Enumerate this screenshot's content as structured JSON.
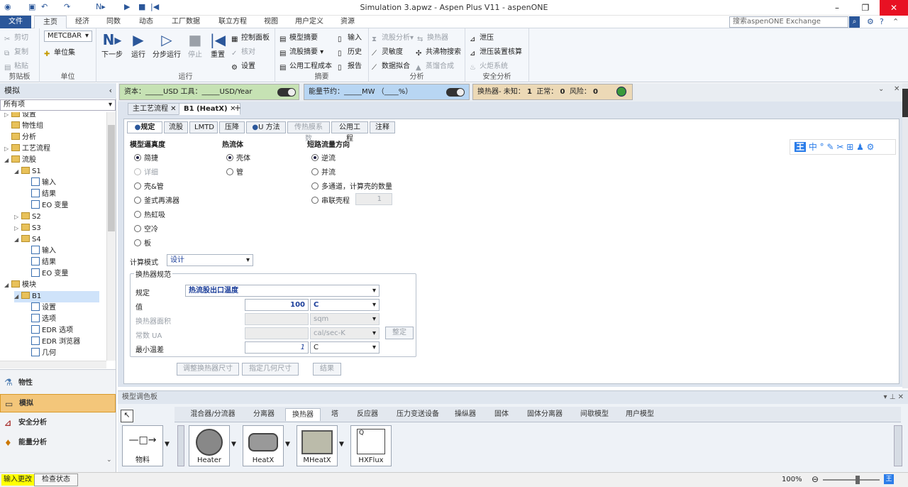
{
  "window": {
    "title": "Simulation 3.apwz - Aspen Plus V11 - aspenONE"
  },
  "ribbon_tabs": [
    "文件",
    "主页",
    "经济",
    "同数",
    "动态",
    "工厂数据",
    "联立方程",
    "视图",
    "用户定义",
    "资源"
  ],
  "search": {
    "placeholder": "搜索aspenONE Exchange"
  },
  "clipboard": {
    "cut": "剪切",
    "copy": "复制",
    "paste": "粘贴",
    "label": "剪贴板"
  },
  "units": {
    "value": "METCBAR",
    "set_label": "单位集",
    "label": "单位"
  },
  "run": {
    "next": "下一步",
    "run": "运行",
    "step": "分步运行",
    "stop": "停止",
    "reset": "重置",
    "control_panel": "控制面板",
    "check": "核对",
    "settings": "设置",
    "label": "运行"
  },
  "summary": {
    "model_summary": "模型摘要",
    "stream_summary": "流股摘要",
    "utility_cost": "公用工程成本",
    "input": "输入",
    "history": "历史",
    "report": "报告",
    "label": "摘要"
  },
  "analysis": {
    "stream_analysis": "流股分析",
    "heat_exchanger": "换热器",
    "sensitivity": "灵敏度",
    "mixture_search": "共沸物搜索",
    "data_regression": "数据拟合",
    "distillation_synthesis": "蒸馏合成",
    "label": "分析"
  },
  "safety": {
    "pressure_relief": "泄压",
    "relief_rating": "泄压装置核算",
    "flare_system": "火炬系统",
    "label": "安全分析"
  },
  "status": {
    "capital": "资本：_____USD  工具：_____USD/Year",
    "energy": "能量节约：_____MW  （____%）",
    "hx_label": "换热器- 未知：",
    "hx_unknown": "1",
    "normal_label": "正常：",
    "normal": "0",
    "risk_label": "风险：",
    "risk": "0"
  },
  "navigator": {
    "title": "模拟",
    "filter": "所有项"
  },
  "tree": [
    {
      "label": "设置",
      "indent": 0,
      "type": "folder",
      "arrow": "▷"
    },
    {
      "label": "物性组",
      "indent": 0,
      "type": "folder",
      "arrow": ""
    },
    {
      "label": "分析",
      "indent": 0,
      "type": "folder",
      "arrow": ""
    },
    {
      "label": "工艺流程",
      "indent": 0,
      "type": "folder",
      "arrow": "▷"
    },
    {
      "label": "流股",
      "indent": 0,
      "type": "folder",
      "arrow": "◢"
    },
    {
      "label": "S1",
      "indent": 1,
      "type": "folder",
      "arrow": "◢"
    },
    {
      "label": "输入",
      "indent": 2,
      "type": "form",
      "arrow": ""
    },
    {
      "label": "结果",
      "indent": 2,
      "type": "form",
      "arrow": ""
    },
    {
      "label": "EO 变量",
      "indent": 2,
      "type": "form",
      "arrow": ""
    },
    {
      "label": "S2",
      "indent": 1,
      "type": "folder",
      "arrow": "▷"
    },
    {
      "label": "S3",
      "indent": 1,
      "type": "folder",
      "arrow": "▷"
    },
    {
      "label": "S4",
      "indent": 1,
      "type": "folder",
      "arrow": "◢"
    },
    {
      "label": "输入",
      "indent": 2,
      "type": "form",
      "arrow": ""
    },
    {
      "label": "结果",
      "indent": 2,
      "type": "form",
      "arrow": ""
    },
    {
      "label": "EO 变量",
      "indent": 2,
      "type": "form",
      "arrow": ""
    },
    {
      "label": "模块",
      "indent": 0,
      "type": "folder",
      "arrow": "◢"
    },
    {
      "label": "B1",
      "indent": 1,
      "type": "folder",
      "arrow": "◢"
    },
    {
      "label": "设置",
      "indent": 2,
      "type": "form",
      "arrow": ""
    },
    {
      "label": "选项",
      "indent": 2,
      "type": "form",
      "arrow": ""
    },
    {
      "label": "EDR 选项",
      "indent": 2,
      "type": "form",
      "arrow": ""
    },
    {
      "label": "EDR 浏览器",
      "indent": 2,
      "type": "form",
      "arrow": ""
    },
    {
      "label": "几何",
      "indent": 2,
      "type": "form",
      "arrow": ""
    }
  ],
  "nav_buttons": [
    "物性",
    "模拟",
    "安全分析",
    "能量分析"
  ],
  "doc_tabs": [
    "主工艺流程",
    "B1 (HeatX)"
  ],
  "form_tabs": [
    "规定",
    "流股",
    "LMTD",
    "压降",
    "U 方法",
    "传热膜系数",
    "公用工程",
    "注释"
  ],
  "form": {
    "model_fidelity_title": "模型逼真度",
    "model_fidelity": [
      "简捷",
      "详细",
      "壳&管",
      "釜式再沸器",
      "热虹吸",
      "空冷",
      "板"
    ],
    "hot_fluid_title": "热流体",
    "hot_fluid": [
      "壳体",
      "管"
    ],
    "flow_title": "短路流量方向",
    "flow": [
      "逆流",
      "并流",
      "多通道，计算壳的数量",
      "串联壳程"
    ],
    "series_shells": "1",
    "calc_mode_label": "计算模式",
    "calc_mode": "设计",
    "spec_group": "换热器规范",
    "spec_label": "规定",
    "spec_value": "热流股出口温度",
    "value_label": "值",
    "value": "100",
    "value_unit": "C",
    "area_label": "换热器面积",
    "area_unit": "sqm",
    "ua_label": "常数 UA",
    "ua_unit": "cal/sec-K",
    "ua_btn": "整定",
    "min_temp_label": "最小温差",
    "min_temp": "1",
    "min_temp_unit": "C",
    "btn_size": "调整换热器尺寸",
    "btn_geometry": "指定几何尺寸",
    "btn_results": "结果"
  },
  "palette": {
    "title": "模型调色板",
    "tabs": [
      "混合器/分流器",
      "分离器",
      "换热器",
      "塔",
      "反应器",
      "压力变送设备",
      "操纵器",
      "固体",
      "固体分离器",
      "间歇模型",
      "用户模型"
    ],
    "items": [
      "物料",
      "Heater",
      "HeatX",
      "MHeatX",
      "HXFlux"
    ]
  },
  "bottom": {
    "input_changed": "输入更改",
    "check_status": "检查状态",
    "zoom": "100%"
  },
  "colors": {
    "file_tab": "#2b579a",
    "cost_box": "#c6e2b4",
    "energy_box": "#b8d6f3",
    "hx_box": "#ecd9b6",
    "selected_nav": "#f3c67a"
  }
}
